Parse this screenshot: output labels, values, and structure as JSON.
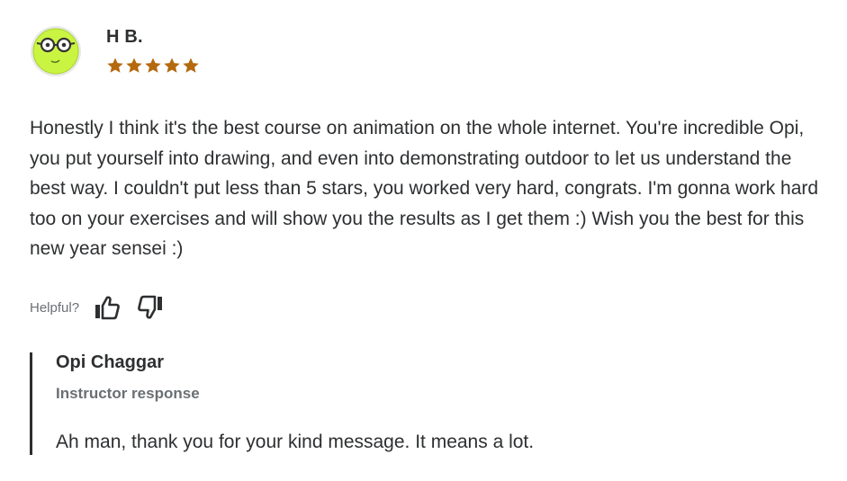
{
  "review": {
    "reviewer_name": "H B.",
    "rating": 5,
    "star_color": "#b4690e",
    "text": "Honestly I think it's the best course on animation on the whole internet. You're incredible Opi, you put yourself into drawing, and even into demonstrating outdoor to let us understand the best way. I couldn't put less than 5 stars, you worked very hard, congrats. I'm gonna work hard too on your exercises and will show you the results as I get them :) Wish you the best for this new year sensei :)"
  },
  "helpful": {
    "label": "Helpful?",
    "thumbs_up_icon": "thumbs-up-icon",
    "thumbs_down_icon": "thumbs-down-icon"
  },
  "instructor_response": {
    "name": "Opi Chaggar",
    "role": "Instructor response",
    "text": "Ah man, thank you for your kind message. It means a lot."
  },
  "colors": {
    "text_primary": "#2d2f31",
    "text_secondary": "#6a6f73",
    "avatar_face": "#c6f53a"
  }
}
